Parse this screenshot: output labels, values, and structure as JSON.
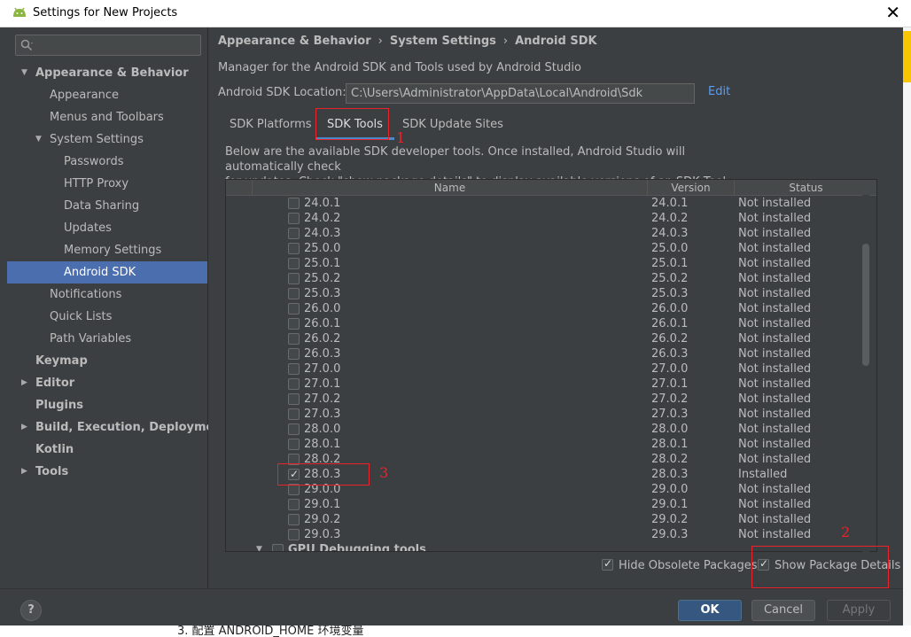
{
  "window": {
    "title": "Settings for New Projects",
    "close_glyph": "✕"
  },
  "sidebar": {
    "search_placeholder": "",
    "items": [
      {
        "label": "Appearance & Behavior",
        "level": 0,
        "bold": true,
        "arrow": "▼"
      },
      {
        "label": "Appearance",
        "level": 1
      },
      {
        "label": "Menus and Toolbars",
        "level": 1
      },
      {
        "label": "System Settings",
        "level": 1,
        "arrow": "▼"
      },
      {
        "label": "Passwords",
        "level": 2
      },
      {
        "label": "HTTP Proxy",
        "level": 2
      },
      {
        "label": "Data Sharing",
        "level": 2
      },
      {
        "label": "Updates",
        "level": 2
      },
      {
        "label": "Memory Settings",
        "level": 2
      },
      {
        "label": "Android SDK",
        "level": 2,
        "selected": true
      },
      {
        "label": "Notifications",
        "level": 1
      },
      {
        "label": "Quick Lists",
        "level": 1
      },
      {
        "label": "Path Variables",
        "level": 1
      },
      {
        "label": "Keymap",
        "level": 0,
        "bold": true
      },
      {
        "label": "Editor",
        "level": 0,
        "bold": true,
        "arrow": "▶"
      },
      {
        "label": "Plugins",
        "level": 0,
        "bold": true
      },
      {
        "label": "Build, Execution, Deployment",
        "level": 0,
        "bold": true,
        "arrow": "▶"
      },
      {
        "label": "Kotlin",
        "level": 0,
        "bold": true
      },
      {
        "label": "Tools",
        "level": 0,
        "bold": true,
        "arrow": "▶"
      }
    ]
  },
  "main": {
    "breadcrumb": [
      "Appearance & Behavior",
      "System Settings",
      "Android SDK"
    ],
    "breadcrumb_sep": "›",
    "description": "Manager for the Android SDK and Tools used by Android Studio",
    "sdk_location_label": "Android SDK Location:",
    "sdk_location_value": "C:\\Users\\Administrator\\AppData\\Local\\Android\\Sdk",
    "edit_label": "Edit",
    "tabs": [
      {
        "label": "SDK Platforms",
        "active": false
      },
      {
        "label": "SDK Tools",
        "active": true
      },
      {
        "label": "SDK Update Sites",
        "active": false
      }
    ],
    "tools_description_line1": "Below are the available SDK developer tools. Once installed, Android Studio will automatically check",
    "tools_description_line2": "for updates. Check \"show package details\" to display available versions of an SDK Tool.",
    "columns": [
      "Name",
      "Version",
      "Status"
    ],
    "rows": [
      {
        "name": "24.0.1",
        "version": "24.0.1",
        "status": "Not installed",
        "checked": false
      },
      {
        "name": "24.0.2",
        "version": "24.0.2",
        "status": "Not installed",
        "checked": false
      },
      {
        "name": "24.0.3",
        "version": "24.0.3",
        "status": "Not installed",
        "checked": false
      },
      {
        "name": "25.0.0",
        "version": "25.0.0",
        "status": "Not installed",
        "checked": false
      },
      {
        "name": "25.0.1",
        "version": "25.0.1",
        "status": "Not installed",
        "checked": false
      },
      {
        "name": "25.0.2",
        "version": "25.0.2",
        "status": "Not installed",
        "checked": false
      },
      {
        "name": "25.0.3",
        "version": "25.0.3",
        "status": "Not installed",
        "checked": false
      },
      {
        "name": "26.0.0",
        "version": "26.0.0",
        "status": "Not installed",
        "checked": false
      },
      {
        "name": "26.0.1",
        "version": "26.0.1",
        "status": "Not installed",
        "checked": false
      },
      {
        "name": "26.0.2",
        "version": "26.0.2",
        "status": "Not installed",
        "checked": false
      },
      {
        "name": "26.0.3",
        "version": "26.0.3",
        "status": "Not installed",
        "checked": false
      },
      {
        "name": "27.0.0",
        "version": "27.0.0",
        "status": "Not installed",
        "checked": false
      },
      {
        "name": "27.0.1",
        "version": "27.0.1",
        "status": "Not installed",
        "checked": false
      },
      {
        "name": "27.0.2",
        "version": "27.0.2",
        "status": "Not installed",
        "checked": false
      },
      {
        "name": "27.0.3",
        "version": "27.0.3",
        "status": "Not installed",
        "checked": false
      },
      {
        "name": "28.0.0",
        "version": "28.0.0",
        "status": "Not installed",
        "checked": false
      },
      {
        "name": "28.0.1",
        "version": "28.0.1",
        "status": "Not installed",
        "checked": false
      },
      {
        "name": "28.0.2",
        "version": "28.0.2",
        "status": "Not installed",
        "checked": false
      },
      {
        "name": "28.0.3",
        "version": "28.0.3",
        "status": "Installed",
        "checked": true
      },
      {
        "name": "29.0.0",
        "version": "29.0.0",
        "status": "Not installed",
        "checked": false
      },
      {
        "name": "29.0.1",
        "version": "29.0.1",
        "status": "Not installed",
        "checked": false
      },
      {
        "name": "29.0.2",
        "version": "29.0.2",
        "status": "Not installed",
        "checked": false
      },
      {
        "name": "29.0.3",
        "version": "29.0.3",
        "status": "Not installed",
        "checked": false
      }
    ],
    "group_row": {
      "label": "GPU Debugging tools",
      "arrow": "▼"
    },
    "hide_obsolete": {
      "label": "Hide Obsolete Packages",
      "checked": true
    },
    "show_details": {
      "label": "Show Package Details",
      "checked": true
    }
  },
  "annotations": [
    "1",
    "2",
    "3"
  ],
  "footer": {
    "help": "?",
    "ok": "OK",
    "cancel": "Cancel",
    "apply": "Apply"
  },
  "background_doc_text": "3. 配置 ANDROID_HOME 环境变量",
  "colors": {
    "accent": "#4b6eaf",
    "annotation_red": "#e8232b",
    "link": "#589df6"
  }
}
